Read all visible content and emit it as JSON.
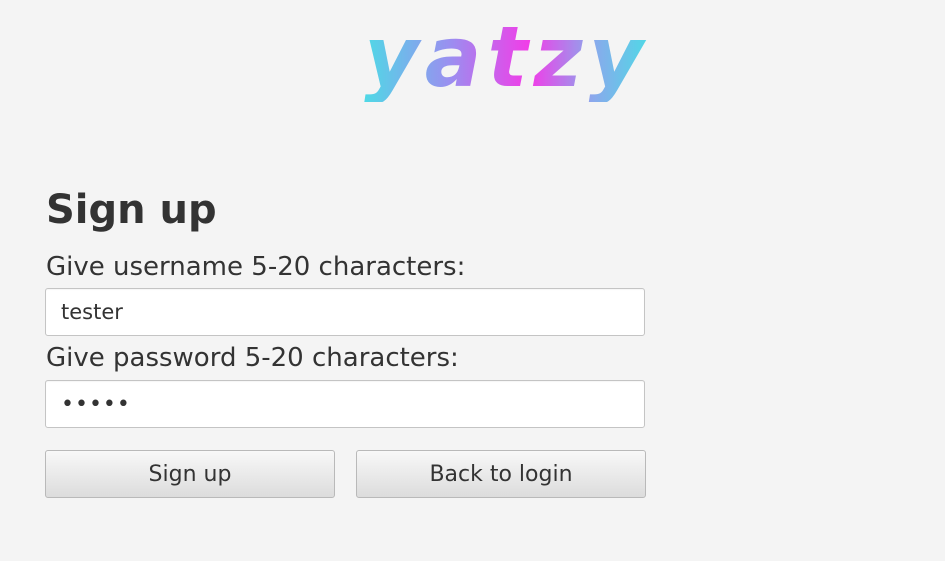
{
  "logo": {
    "text": "yatzy",
    "gradient_colors": [
      "#4fd9e6",
      "#9a8ff0",
      "#f23ce8",
      "#8ba8ec",
      "#4fd9e6"
    ]
  },
  "heading": "Sign up",
  "form": {
    "username_label": "Give username 5-20 characters:",
    "username_value": "tester",
    "password_label": "Give password 5-20 characters:",
    "password_value": "•••••"
  },
  "buttons": {
    "signup_label": "Sign up",
    "back_label": "Back to login"
  }
}
